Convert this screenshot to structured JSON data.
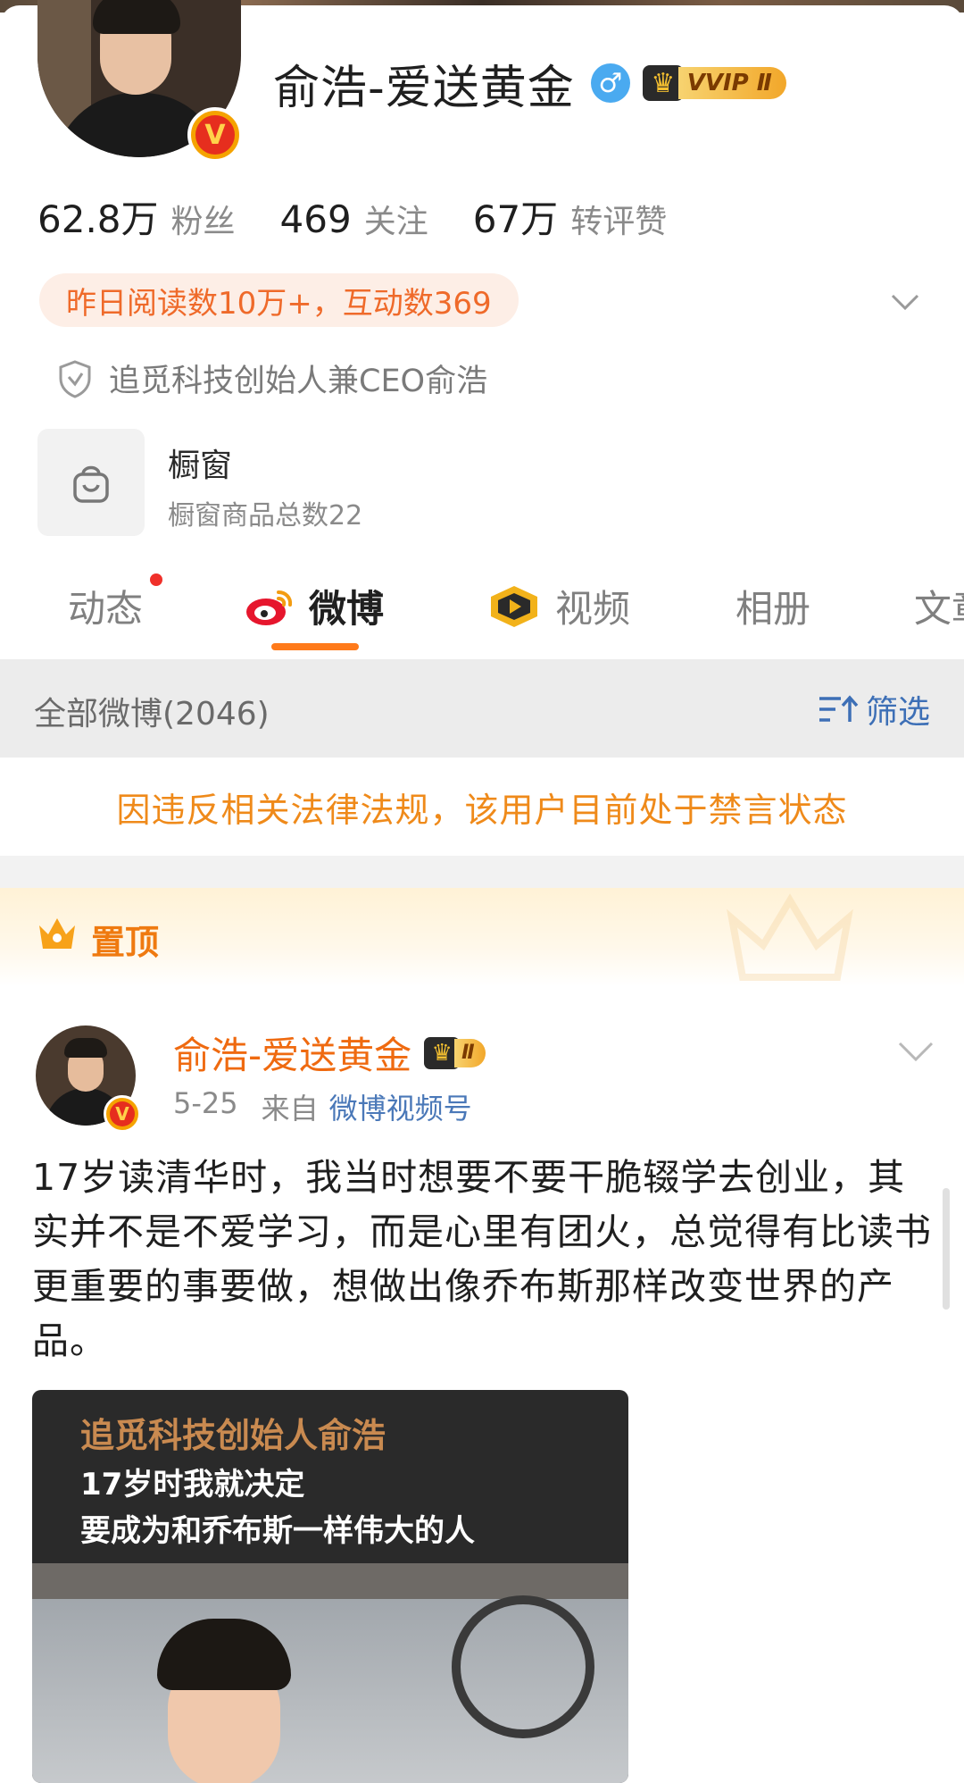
{
  "profile": {
    "name": "俞浩-爱送黄金",
    "gender_symbol": "♂",
    "vip_badge": "VVIP Ⅱ",
    "verified_mark": "V",
    "stats": [
      {
        "value": "62.8万",
        "label": "粉丝"
      },
      {
        "value": "469",
        "label": "关注"
      },
      {
        "value": "67万",
        "label": "转评赞"
      }
    ],
    "read_stats": "昨日阅读数10万+，互动数369",
    "verification": "追觅科技创始人兼CEO俞浩",
    "shop": {
      "title": "橱窗",
      "subtitle": "橱窗商品总数22"
    }
  },
  "tabs": [
    {
      "label": "动态",
      "has_dot": true
    },
    {
      "label": "微博",
      "active": true
    },
    {
      "label": "视频"
    },
    {
      "label": "相册"
    },
    {
      "label": "文章"
    }
  ],
  "filter": {
    "all_label": "全部微博(2046)",
    "filter_label": "筛选"
  },
  "ban_notice": "因违反相关法律法规，该用户目前处于禁言状态",
  "pinned_label": "置顶",
  "post": {
    "author": "俞浩-爱送黄金",
    "vip_badge": "Ⅱ",
    "date": "5-25",
    "from_label": "来自",
    "source": "微博视频号",
    "text": "17岁读清华时，我当时想要不要干脆辍学去创业，其实并不是不爱学习，而是心里有团火，总觉得有比读书更重要的事要做，想做出像乔布斯那样改变世界的产品。",
    "video_caption_1": "追觅科技创始人俞浩",
    "video_caption_2": "17岁时我就决定",
    "video_caption_3": "要成为和乔布斯一样伟大的人"
  },
  "colors": {
    "accent_orange": "#ff7a1a",
    "link_blue": "#3d6fb6",
    "ban_text": "#ef8a1a"
  },
  "icons": [
    "gender-male-icon",
    "vip-crown-icon",
    "chevron-down-icon",
    "shield-icon",
    "shopping-bag-icon",
    "weibo-logo-icon",
    "video-icon",
    "filter-icon",
    "crown-icon"
  ]
}
